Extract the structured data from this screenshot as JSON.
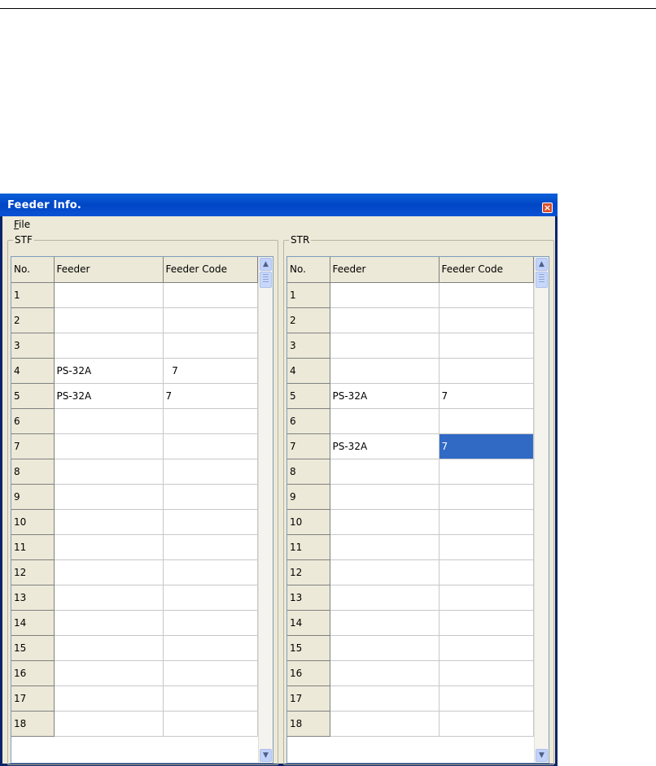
{
  "window": {
    "title": "Feeder Info.",
    "close_glyph": "×"
  },
  "menu": {
    "file_mnemonic": "F",
    "file_rest": "ile"
  },
  "groups": [
    {
      "label": "STF",
      "columns": [
        "No.",
        "Feeder",
        "Feeder Code"
      ],
      "rows": [
        [
          "1",
          "",
          ""
        ],
        [
          "2",
          "",
          ""
        ],
        [
          "3",
          "",
          ""
        ],
        [
          "4",
          "PS-32A",
          "  7"
        ],
        [
          "5",
          "PS-32A",
          "7"
        ],
        [
          "6",
          "",
          ""
        ],
        [
          "7",
          "",
          ""
        ],
        [
          "8",
          "",
          ""
        ],
        [
          "9",
          "",
          ""
        ],
        [
          "10",
          "",
          ""
        ],
        [
          "11",
          "",
          ""
        ],
        [
          "12",
          "",
          ""
        ],
        [
          "13",
          "",
          ""
        ],
        [
          "14",
          "",
          ""
        ],
        [
          "15",
          "",
          ""
        ],
        [
          "16",
          "",
          ""
        ],
        [
          "17",
          "",
          ""
        ],
        [
          "18",
          "",
          ""
        ]
      ],
      "selected_row": -1
    },
    {
      "label": "STR",
      "columns": [
        "No.",
        "Feeder",
        "Feeder Code"
      ],
      "rows": [
        [
          "1",
          "",
          ""
        ],
        [
          "2",
          "",
          ""
        ],
        [
          "3",
          "",
          ""
        ],
        [
          "4",
          "",
          ""
        ],
        [
          "5",
          "PS-32A",
          "7"
        ],
        [
          "6",
          "",
          ""
        ],
        [
          "7",
          "PS-32A",
          "7"
        ],
        [
          "8",
          "",
          ""
        ],
        [
          "9",
          "",
          ""
        ],
        [
          "10",
          "",
          ""
        ],
        [
          "11",
          "",
          ""
        ],
        [
          "12",
          "",
          ""
        ],
        [
          "13",
          "",
          ""
        ],
        [
          "14",
          "",
          ""
        ],
        [
          "15",
          "",
          ""
        ],
        [
          "16",
          "",
          ""
        ],
        [
          "17",
          "",
          ""
        ],
        [
          "18",
          "",
          ""
        ]
      ],
      "selected_row": 6
    }
  ],
  "icons": {
    "scroll_up": "chevron-up-icon",
    "scroll_down": "chevron-down-icon",
    "close": "close-icon"
  },
  "colors": {
    "titlebar": "#0046c6",
    "selection": "#316ac5",
    "dialog_bg": "#ece9d8"
  }
}
